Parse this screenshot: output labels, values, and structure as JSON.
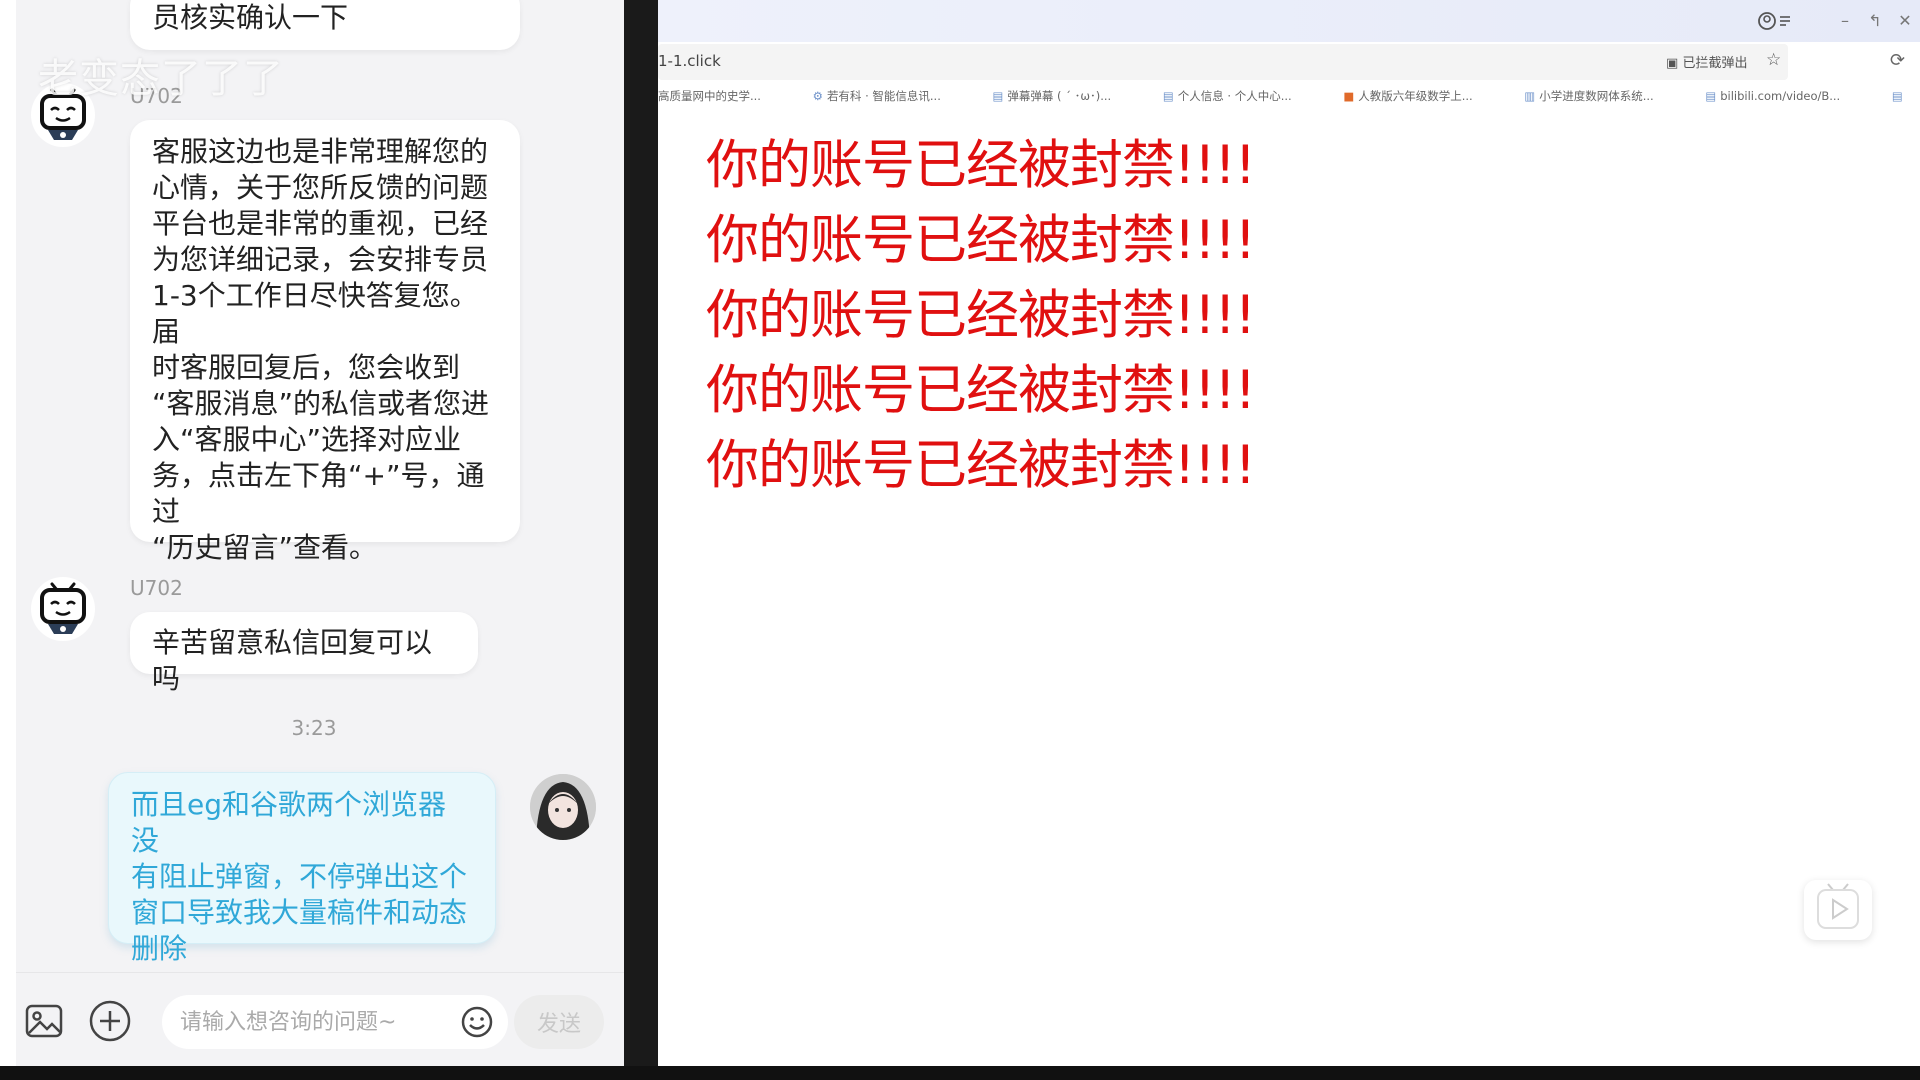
{
  "chat": {
    "watermark": "老变态了了了",
    "top_message": "员核实确认一下",
    "agent_name": "U702",
    "long_message": "客服这边也是非常理解您的\n心情，关于您所反馈的问题\n平台也是非常的重视，已经\n为您详细记录，会安排专员\n1-3个工作日尽快答复您。届\n时客服回复后，您会收到\n“客服消息”的私信或者您进\n入“客服中心”选择对应业\n务，点击左下角“+”号，通过\n“历史留言”查看。",
    "short_message": "辛苦留意私信回复可以吗",
    "timestamp": "3:23",
    "my_message": "而且eg和谷歌两个浏览器没\n有阻止弹窗，不停弹出这个\n窗口导致我大量稿件和动态\n删除",
    "input_placeholder": "请输入想咨询的问题~",
    "send_label": "发送"
  },
  "browser": {
    "url": "1-1.click",
    "popup_blocked_label": "已拦截弹出",
    "bookmarks": [
      "高质量网中的史学...",
      "若有科 · 智能信息讯...",
      "弹幕弹幕 ( ´ ･ω･)...",
      "个人信息 · 个人中心...",
      "人教版六年级数学上...",
      "小学进度数网体系统...",
      "bilibili.com/video/B..."
    ],
    "banned_lines": [
      "你的账号已经被封禁!!!!",
      "你的账号已经被封禁!!!!",
      "你的账号已经被封禁!!!!",
      "你的账号已经被封禁!!!!",
      "你的账号已经被封禁!!!!"
    ],
    "banned_color": "#e01010"
  },
  "colors": {
    "my_bubble_text": "#30a8d8",
    "my_bubble_bg": "#e9f8fc",
    "chat_bg": "#f3f3f5"
  }
}
